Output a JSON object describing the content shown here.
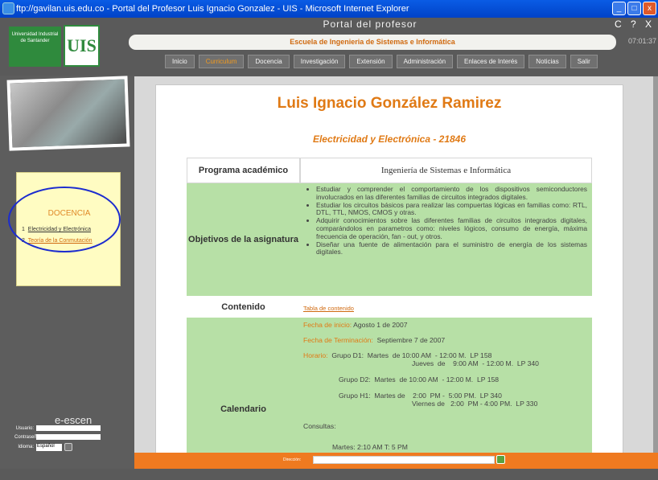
{
  "window": {
    "title": "ftp://gavilan.uis.edu.co - Portal del Profesor Luis Ignacio Gonzalez - UIS - Microsoft Internet Explorer",
    "controls": [
      "_",
      "□",
      "x"
    ]
  },
  "header": {
    "logo_text": "Universidad Industrial de Santander",
    "logo_mark": "UIS",
    "portal_title": "Portal del profesor",
    "right_icons": "C ? X",
    "school": "Escuela de Ingenieria de Sistemas e Informática",
    "clock": "07:01:37",
    "nav": [
      "Inicio",
      "Curriculum",
      "Docencia",
      "Investigación",
      "Extensión",
      "Administración",
      "Enlaces de Interés",
      "Noticias",
      "Salir"
    ]
  },
  "sidebar": {
    "docencia_title": "DOCENCIA",
    "items": [
      {
        "num": "1",
        "label": "Electricidad y Electrónica"
      },
      {
        "num": "2",
        "label": "Teoría de la Conmutación"
      }
    ],
    "login": {
      "brand": "e-escen",
      "user_label": "Usuario:",
      "pass_label": "Contraseña:",
      "lang_label": "Idioma:",
      "lang_value": "Español"
    }
  },
  "main": {
    "name": "Luis Ignacio González Ramirez",
    "course": "Electricidad y Electrónica - 21846",
    "rows": {
      "programa_label": "Programa académico",
      "programa_value": "Ingeniería de Sistemas e Informática",
      "objetivos_label": "Objetivos de la asignatura",
      "objetivos": [
        "Estudiar y comprender el comportamiento de los dispositivos semiconductores involucrados en las diferentes familias de circuitos integrados digitales.",
        "Estudiar los circuitos básicos para realizar las compuertas lógicas en familias como: RTL, DTL, TTL, NMOS, CMOS y otras.",
        "Adquirir conocimientos sobre las diferentes familias de circuitos integrados digitales, comparándolos en parametros como: niveles lógicos, consumo de energía, máxima frecuencia de operación, fan - out, y otros.",
        "Diseñar una fuente de alimentación para el suministro de energía de los sistemas digitales."
      ],
      "contenido_label": "Contenido",
      "contenido_link": "Tabla de contenido",
      "calendario_label": "Calendario",
      "fecha_inicio_label": "Fecha de inicio:",
      "fecha_inicio": "Agosto 1 de 2007",
      "fecha_term_label": "Fecha de Terminación:",
      "fecha_term": "Septiembre 7 de 2007",
      "horario_label": "Horario:",
      "h1": "Grupo D1:  Martes  de 10:00 AM  - 12:00 M.  LP 158",
      "h2": "Jueves  de    9:00 AM  - 12:00 M.  LP 340",
      "h3": "Grupo D2:  Martes  de 10:00 AM  - 12:00 M.  LP 158",
      "h4": "Grupo H1:  Martes de    2:00  PM -  5:00 PM.  LP 340",
      "h5": "Viernes de   2:00  PM - 4:00 PM.  LP 330",
      "consultas_label": "Consultas:",
      "consultas_partial": "Martes: 2:10 AM T: 5 PM"
    }
  },
  "bottom": {
    "dir_label": "Dirección:"
  }
}
